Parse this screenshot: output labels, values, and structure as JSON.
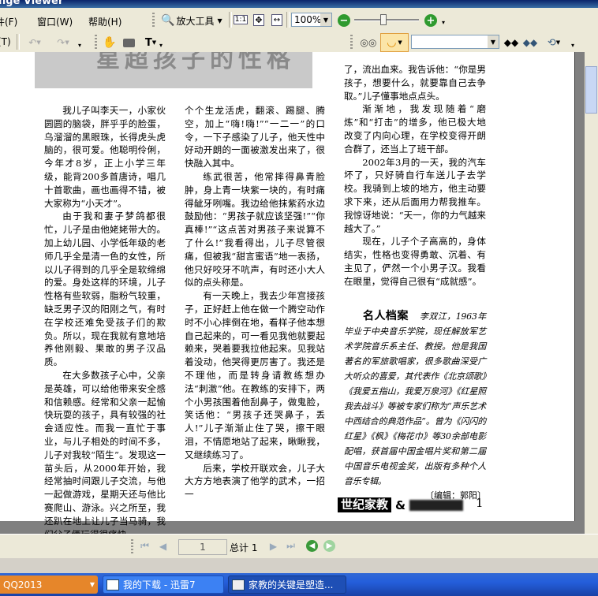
{
  "window": {
    "title_fragment": "nge Viewer"
  },
  "menubar": {
    "items": [
      "件(F)",
      "窗口(W)",
      "帮助(H)"
    ]
  },
  "toolbar": {
    "zoom_tool_label": "放大工具",
    "zoom_value": "100%",
    "zoom_slider_level": 0.45
  },
  "page": {
    "heading_fragment": "星超孩子的性格",
    "col1": [
      "我儿子叫李天一，小家伙圆圆的脑袋，胖乎乎的脸蛋，乌溜溜的黑眼珠，长得虎头虎脑的，很可爱。他聪明伶俐，今年才8岁，正上小学三年级，能背200多首唐诗，唱几十首歌曲，画也画得不错，被大家称为“小天才”。",
      "由于我和妻子梦鸽都很忙，儿子是由他姥姥带大的。加上幼儿园、小学低年级的老师几乎全是清一色的女性，所以儿子得到的几乎全是软绵绵的爱。身处这样的环境，儿子性格有些软弱，脂粉气较重，缺乏男子汉的阳刚之气，有时在学校还难免受孩子们的欺负。所以，现在我就有意地培养他刚毅、果敢的男子汉品质。",
      "在大多数孩子心中，父亲是英雄，可以给他带来安全感和信赖感。经常和父亲一起愉快玩耍的孩子，具有较强的社会适应性。而我一直忙于事业，与儿子相处的时间不多，儿子对我较“陌生”。发现这一苗头后，从2000年开始，我经常抽时间跟儿子交流，与他一起做游戏，星期天还与他比赛爬山、游泳。兴之所至，我还趴在地上让儿子当马骑，我们父子俩玩得很痛快。"
    ],
    "col2": [
      "个个生龙活虎，翻滚、踢腿、腾空，加上“嗨!嗨!”“一二一”的口令，一下子感染了儿子，他天性中好动开朗的一面被激发出来了，很快融入其中。",
      "练武很苦，他常摔得鼻青脸肿，身上青一块紫一块的，有时痛得龇牙咧嘴。我边给他抹紫药水边鼓励他：“男孩子就应该坚强!”“你真棒!”“这点苦对男孩子来说算不了什么!”我看得出，儿子尽管很痛，但被我“甜言蜜语”地一表扬，他只好咬牙不吭声，有时还小大人似的点头称是。",
      "有一天晚上，我去少年宫接孩子，正好赶上他在做一个腾空动作时不小心摔倒在地，看样子他本想自己起来的，可一看见我他就要起赖来，哭着要我拉他起来。见我站着没动，他哭得更厉害了。我还是不理他，而是转身请教练想办法“刺激”他。在教练的安排下，两个小男孩围着他刮鼻子，做鬼脸，笑话他：“男孩子还哭鼻子，丢人!”儿子渐渐止住了哭，擦干眼泪，不情愿地站了起来，瞅瞅我，又继续练习了。",
      "后来，学校开联欢会，儿子大大方方地表演了他学的武术，一招一"
    ],
    "col3": [
      "了，流出血来。我告诉他：“你是男孩子，想要什么，就要靠自己去争取。”儿子懂事地点点头。",
      "渐渐地，我发现随着“磨炼”和“打击”的增多，他已极大地改变了内向心理，在学校变得开朗合群了，还当上了班干部。",
      "2002年3月的一天，我的汽车坏了，只好骑自行车送儿子去学校。我骑到上坡的地方，他主动要求下来，还从后面用力帮我推车。我惊讶地说：“天一，你的力气越来越大了。”",
      "现在，儿子个子高高的，身体结实，性格也变得勇敢、沉着、有主见了，俨然一个小男子汉。我看在眼里，觉得自己很有“成就感”。"
    ],
    "bio": {
      "title": "名人档案",
      "text": "李双江，1963年毕业于中央音乐学院，现任解放军艺术学院音乐系主任、教授。他是我国著名的军旅歌唱家，很多歌曲深受广大听众的喜爱，其代表作《北京颂歌》《我爱五指山，我爱万泉河》《红星照我去战斗》等被专家们称为“声乐艺术中西结合的典范作品”。曾为《闪闪的红星》《枫》《梅花巾》等30余部电影配唱，获首届中国金唱片奖和第二届中国音乐电视金奖，出版有多种个人音乐专辑。",
      "editor": "〔编辑：郭阳〕"
    },
    "brand_logo": "世纪家教",
    "brand_amp": "&",
    "page_number": "1"
  },
  "navbar": {
    "current_page": "1",
    "total_label": "总计 1"
  },
  "taskbar": {
    "items": [
      {
        "label": "QQ2013"
      },
      {
        "label": "我的下载 - 迅雷7"
      },
      {
        "label": "家教的关键是塑造..."
      }
    ]
  }
}
